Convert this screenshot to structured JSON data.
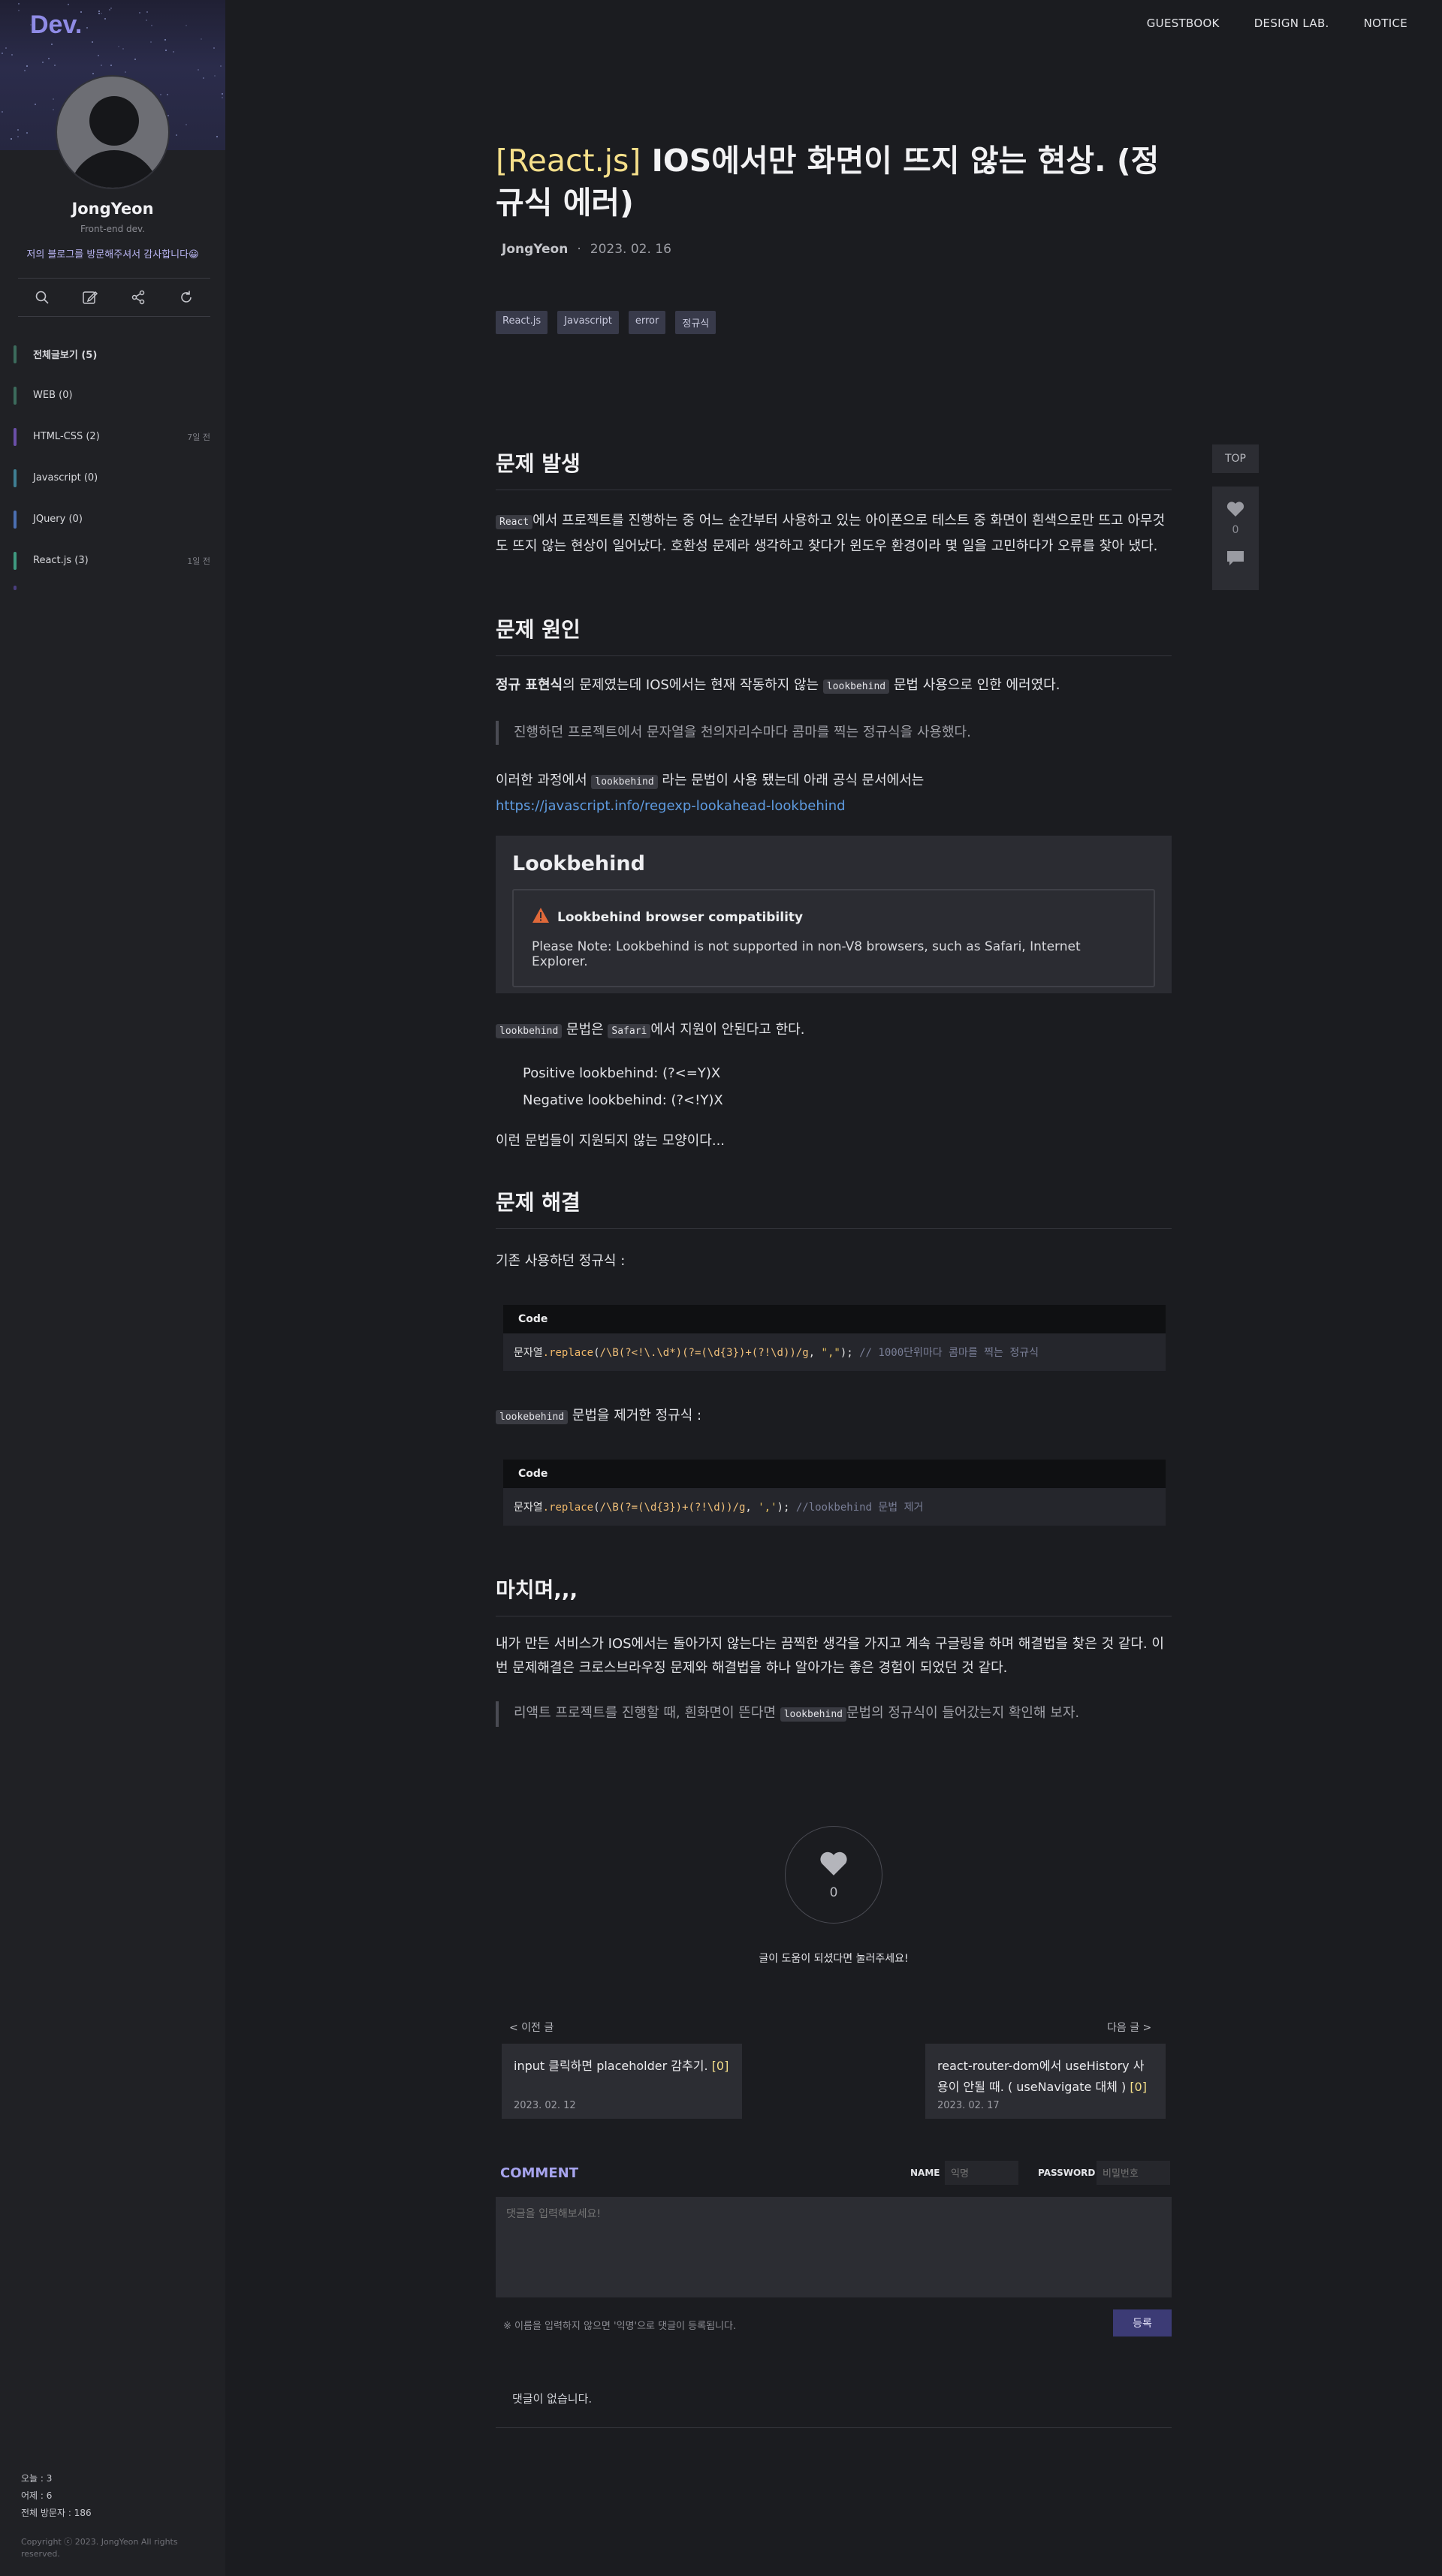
{
  "sidebar": {
    "logo": "Dev.",
    "profile": {
      "name": "JongYeon",
      "role": "Front-end dev.",
      "message": "저의 블로그를 방문해주셔서 감사합니다😀"
    },
    "tools": [
      "search-icon",
      "write-icon",
      "share-icon",
      "refresh-icon"
    ],
    "categories": [
      {
        "label": "전체글보기 (5)",
        "color": "#3c6b5c",
        "ago": ""
      },
      {
        "label": "WEB (0)",
        "color": "#3c6b5c",
        "ago": ""
      },
      {
        "label": "HTML-CSS (2)",
        "color": "#6a4fa8",
        "ago": "7일 전"
      },
      {
        "label": "Javascript (0)",
        "color": "#3f7f93",
        "ago": ""
      },
      {
        "label": "JQuery (0)",
        "color": "#4b6fb2",
        "ago": ""
      },
      {
        "label": "React.js (3)",
        "color": "#3f9a80",
        "ago": "1일 전"
      }
    ],
    "stats": {
      "today": "오늘 : 3",
      "yesterday": "어제 : 6",
      "total": "전체 방문자 : 186"
    },
    "copyright": "Copyright ⓒ 2023. JongYeon All rights reserved."
  },
  "nav": {
    "guestbook": "GUESTBOOK",
    "design_lab": "DESIGN LAB.",
    "notice": "NOTICE"
  },
  "post": {
    "category": "[React.js]",
    "title": " IOS에서만 화면이 뜨지 않는 현상. (정규식 에러)",
    "author": "JongYeon",
    "date": "2023. 02. 16",
    "tags": [
      "React.js",
      "Javascript",
      "error",
      "정규식"
    ],
    "s1": {
      "heading": "문제 발생",
      "code": "React",
      "text": "에서 프로젝트를 진행하는 중 어느 순간부터 사용하고 있는 아이폰으로 테스트 중 화면이 흰색으로만 뜨고 아무것도 뜨지 않는 현상이 일어났다. 호환성 문제라 생각하고 찾다가 윈도우 환경이라 몇 일을 고민하다가 오류를 찾아 냈다."
    },
    "s2": {
      "heading": "문제 원인",
      "bold": "정규 표현식",
      "text1": "의 문제였는데 IOS에서는 현재 작동하지 않는 ",
      "code": "lookbehind",
      "text2": " 문법 사용으로 인한 에러였다.",
      "quote": "진행하던 프로젝트에서 문자열을 천의자리수마다 콤마를 찍는 정규식을 사용했다.",
      "line_a1": "이러한 과정에서 ",
      "line_a_code": "lookbehind",
      "line_a2": " 라는 문법이 사용 됐는데 아래 공식 문서에서는",
      "link": "https://javascript.info/regexp-lookahead-lookbehind",
      "box_title": "Lookbehind",
      "warn_title": "Lookbehind browser compatibility",
      "warn_text": "Please Note: Lookbehind is not supported in non-V8 browsers, such as Safari, Internet Explorer.",
      "line_b_code1": "lookbehind",
      "line_b1": " 문법은 ",
      "line_b_code2": "Safari",
      "line_b2": "에서 지원이 안된다고 한다.",
      "list": [
        "Positive lookbehind: (?<=Y)X",
        "Negative lookbehind: (?<!Y)X"
      ],
      "closing": "이런 문법들이 지원되지 않는 모양이다..."
    },
    "s3": {
      "heading": "문제 해결",
      "intro": "기존 사용하던 정규식 :",
      "code_label": "Code",
      "code1": {
        "obj": "문자열",
        "fn": ".replace",
        "open": "(",
        "regex": "/\\B(?<!\\.\\d*)(?=(\\d{3})+(?!\\d))/g",
        "comma": ", ",
        "str": "\",\"",
        "close": ");",
        "comment": " // 1000단위마다 콤마를 찍는 정규식"
      },
      "intro2_code": "lookebehind",
      "intro2": " 문법을 제거한 정규식 :",
      "code2": {
        "obj": "문자열",
        "fn": ".replace",
        "open": "(",
        "regex": "/\\B(?=(\\d{3})+(?!\\d))/g",
        "comma": ", ",
        "str": "','",
        "close": ");",
        "comment": " //lookbehind 문법 제거"
      }
    },
    "s4": {
      "heading": "마치며,,,",
      "text": "내가 만든 서비스가 IOS에서는 돌아가지 않는다는 끔찍한 생각을 가지고 계속 구글링을 하며 해결법을 찾은 것 같다. 이번 문제해결은 크로스브라우징 문제와 해결법을 하나 알아가는 좋은 경험이 되었던 것 같다.",
      "quote1": "리액트 프로젝트를 진행할 때, 흰화면이 뜬다면 ",
      "quote_code": "lookbehind",
      "quote2": "문법의 정규식이 들어갔는지 확인해 보자."
    }
  },
  "floaters": {
    "top": "TOP",
    "likes": "0"
  },
  "like": {
    "count": "0",
    "message": "글이 도움이 되셨다면 눌러주세요!"
  },
  "pager": {
    "prev_label": "< 이전 글",
    "next_label": "다음 글 >",
    "prev_title": "input 클릭하면 placeholder 감추기. ",
    "prev_count": "[0]",
    "prev_date": "2023. 02. 12",
    "next_title": "react-router-dom에서 useHistory 사용이 안될 때. ( useNavigate 대체 ) ",
    "next_count": "[0]",
    "next_date": "2023. 02. 17"
  },
  "comment": {
    "heading": "COMMENT",
    "name_label": "NAME",
    "name_placeholder": "익명",
    "password_label": "PASSWORD",
    "password_placeholder": "비밀번호",
    "placeholder": "댓글을 입력해보세요!",
    "note": "※ 이름을 입력하지 않으면 '익명'으로 댓글이 등록됩니다.",
    "submit": "등록",
    "empty": "댓글이 없습니다."
  }
}
